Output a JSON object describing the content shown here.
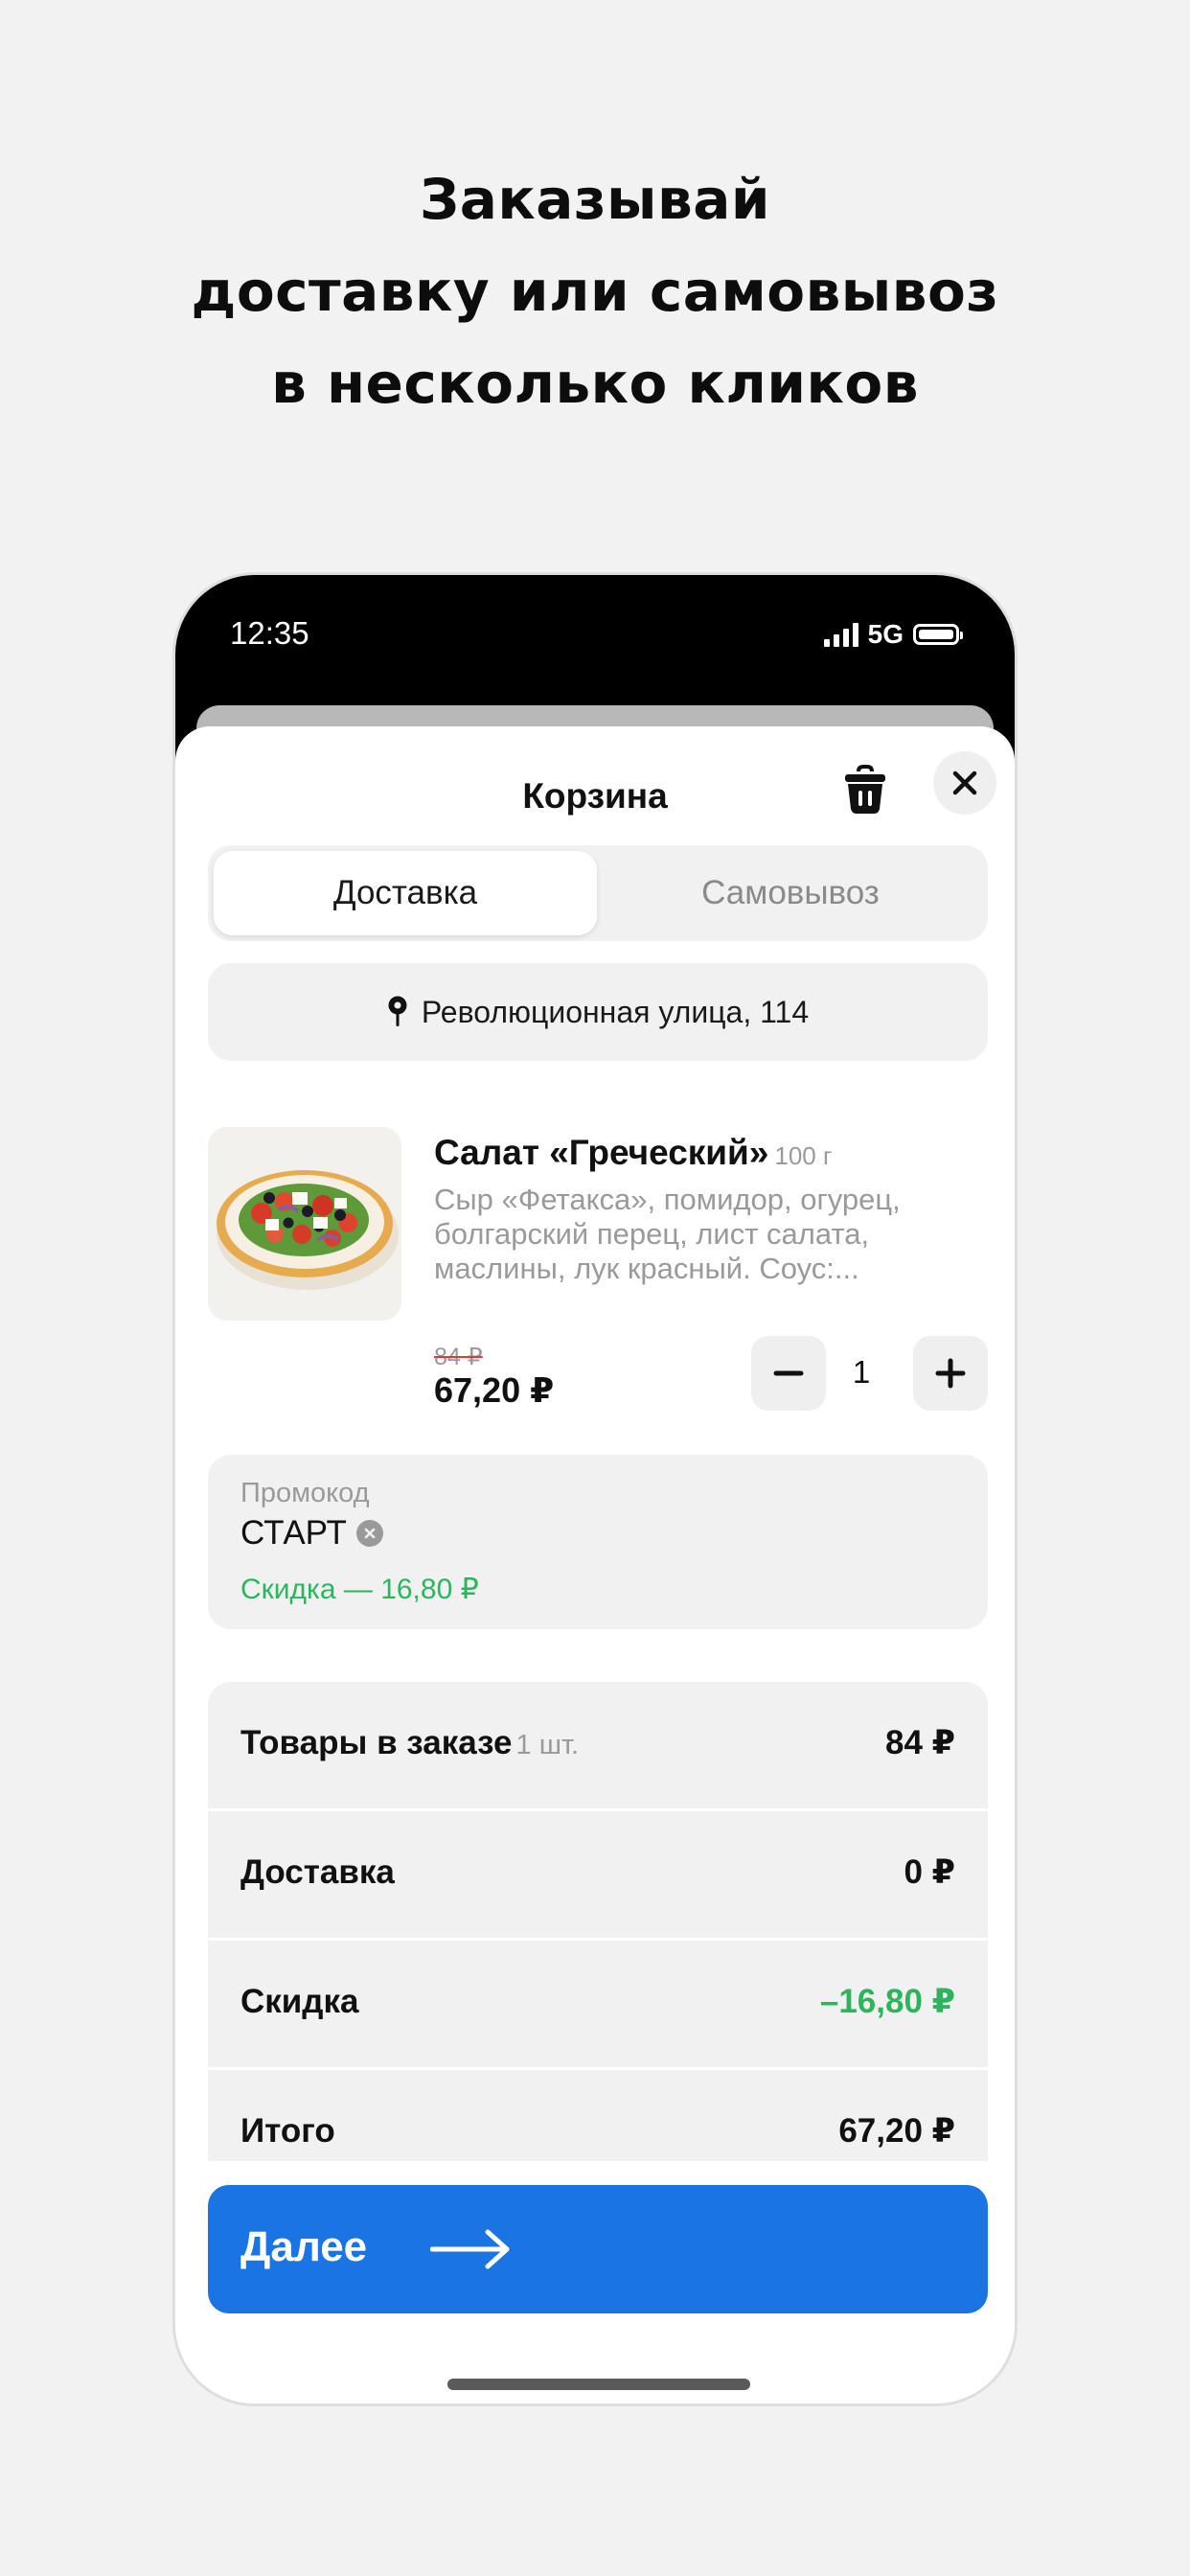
{
  "promo_headline": {
    "line1": "Заказывай",
    "line2": "доставку или самовывоз",
    "line3": "в несколько кликов"
  },
  "status_bar": {
    "time": "12:35",
    "network": "5G",
    "icons": [
      "signal-icon",
      "battery-icon"
    ]
  },
  "cart": {
    "title": "Корзина",
    "icons": [
      "trash-icon",
      "close-icon"
    ],
    "tabs": [
      {
        "label": "Доставка",
        "active": true
      },
      {
        "label": "Самовывоз",
        "active": false
      }
    ],
    "address": "Революционная улица, 114",
    "item": {
      "name": "Салат «Греческий»",
      "weight": "100 г",
      "description": "Сыр «Фетакса», помидор, огурец, болгарский перец, лист салата, маслины, лук красный. Соус:...",
      "old_price": "84 ₽",
      "price": "67,20 ₽",
      "quantity": "1"
    },
    "promo": {
      "label": "Промокод",
      "code": "СТАРТ",
      "discount": "Скидка — 16,80 ₽"
    },
    "summary": [
      {
        "label": "Товары в заказе",
        "sub": "1 шт.",
        "value": "84 ₽"
      },
      {
        "label": "Доставка",
        "sub": "",
        "value": "0 ₽"
      },
      {
        "label": "Скидка",
        "sub": "",
        "value": "–16,80 ₽"
      },
      {
        "label": "Итого",
        "sub": "",
        "value": "67,20 ₽"
      }
    ],
    "next_button": "Далее"
  },
  "colors": {
    "accent": "#1b74e4",
    "discount_green": "#2db55d",
    "muted": "#9a9a9a",
    "panel": "#f1f1f1"
  }
}
